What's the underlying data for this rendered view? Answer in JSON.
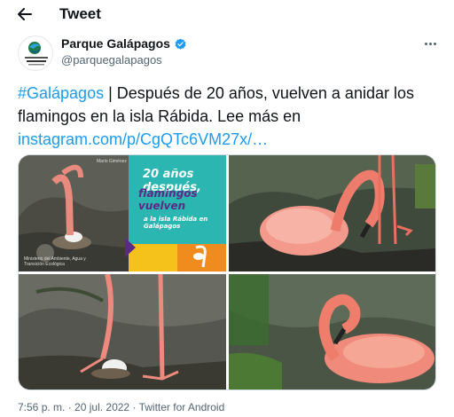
{
  "header": {
    "title": "Tweet",
    "back_icon": "arrow-left-icon"
  },
  "author": {
    "name": "Parque Galápagos",
    "handle": "@parquegalapagos",
    "verified": true,
    "logo_text": "PARQUE NACIONAL GALÁPAGOS"
  },
  "tweet": {
    "hashtag": "#Galápagos",
    "text_after_hashtag": " | Después de 20 años, vuelven a anidar los flamingos en la isla Rábida. Lee más en ",
    "link": "instagram.com/p/CgQTc6VM27x/…"
  },
  "media": {
    "overlay": {
      "line1": "20 años después,",
      "line2": "flamingos vuelven",
      "line3": "a la isla Rábida en Galápagos",
      "credit_top": "Mario Giménez",
      "credit_bottom": "Ministerio del Ambiente, Agua y Transición Ecológica"
    },
    "colors": {
      "teal": "#2bb6b1",
      "purple": "#5b2a86",
      "yellow": "#f5c21b",
      "orange": "#f08b1e",
      "flamingo": "#f07a6a"
    }
  },
  "meta": {
    "time": "7:56 p. m.",
    "separator": " · ",
    "date": "20 jul. 2022",
    "source": "Twitter for Android"
  },
  "colors": {
    "link": "#1d9bf0",
    "secondary": "#536471",
    "verified": "#1d9bf0"
  }
}
